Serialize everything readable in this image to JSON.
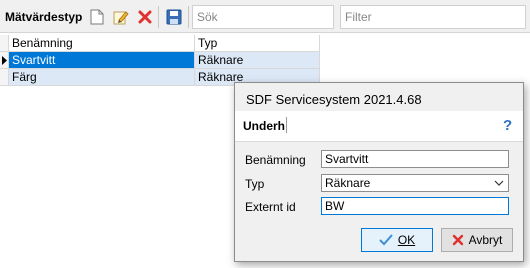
{
  "toolbar": {
    "title": "Mätvärdestyp",
    "search_placeholder": "Sök",
    "filter_placeholder": "Filter",
    "icons": [
      "new-document-icon",
      "edit-pencil-icon",
      "delete-x-icon",
      "save-disk-icon"
    ]
  },
  "grid": {
    "columns": [
      "Benämning",
      "Typ"
    ],
    "rows": [
      {
        "name": "Svartvitt",
        "type": "Räknare",
        "selected": true
      },
      {
        "name": "Färg",
        "type": "Räknare",
        "selected": false
      }
    ]
  },
  "dialog": {
    "title": "SDF Servicesystem 2021.4.68",
    "tab": "Underh",
    "help_icon": "question-icon",
    "fields": {
      "name_label": "Benämning",
      "name_value": "Svartvitt",
      "type_label": "Typ",
      "type_value": "Räknare",
      "extid_label": "Externt id",
      "extid_value": "BW"
    },
    "buttons": {
      "ok": "OK",
      "cancel": "Avbryt"
    }
  },
  "colors": {
    "selection": "#0078d7",
    "row_highlight": "#dce8f6",
    "delete_red": "#e03030",
    "help_blue": "#2f73c3"
  }
}
